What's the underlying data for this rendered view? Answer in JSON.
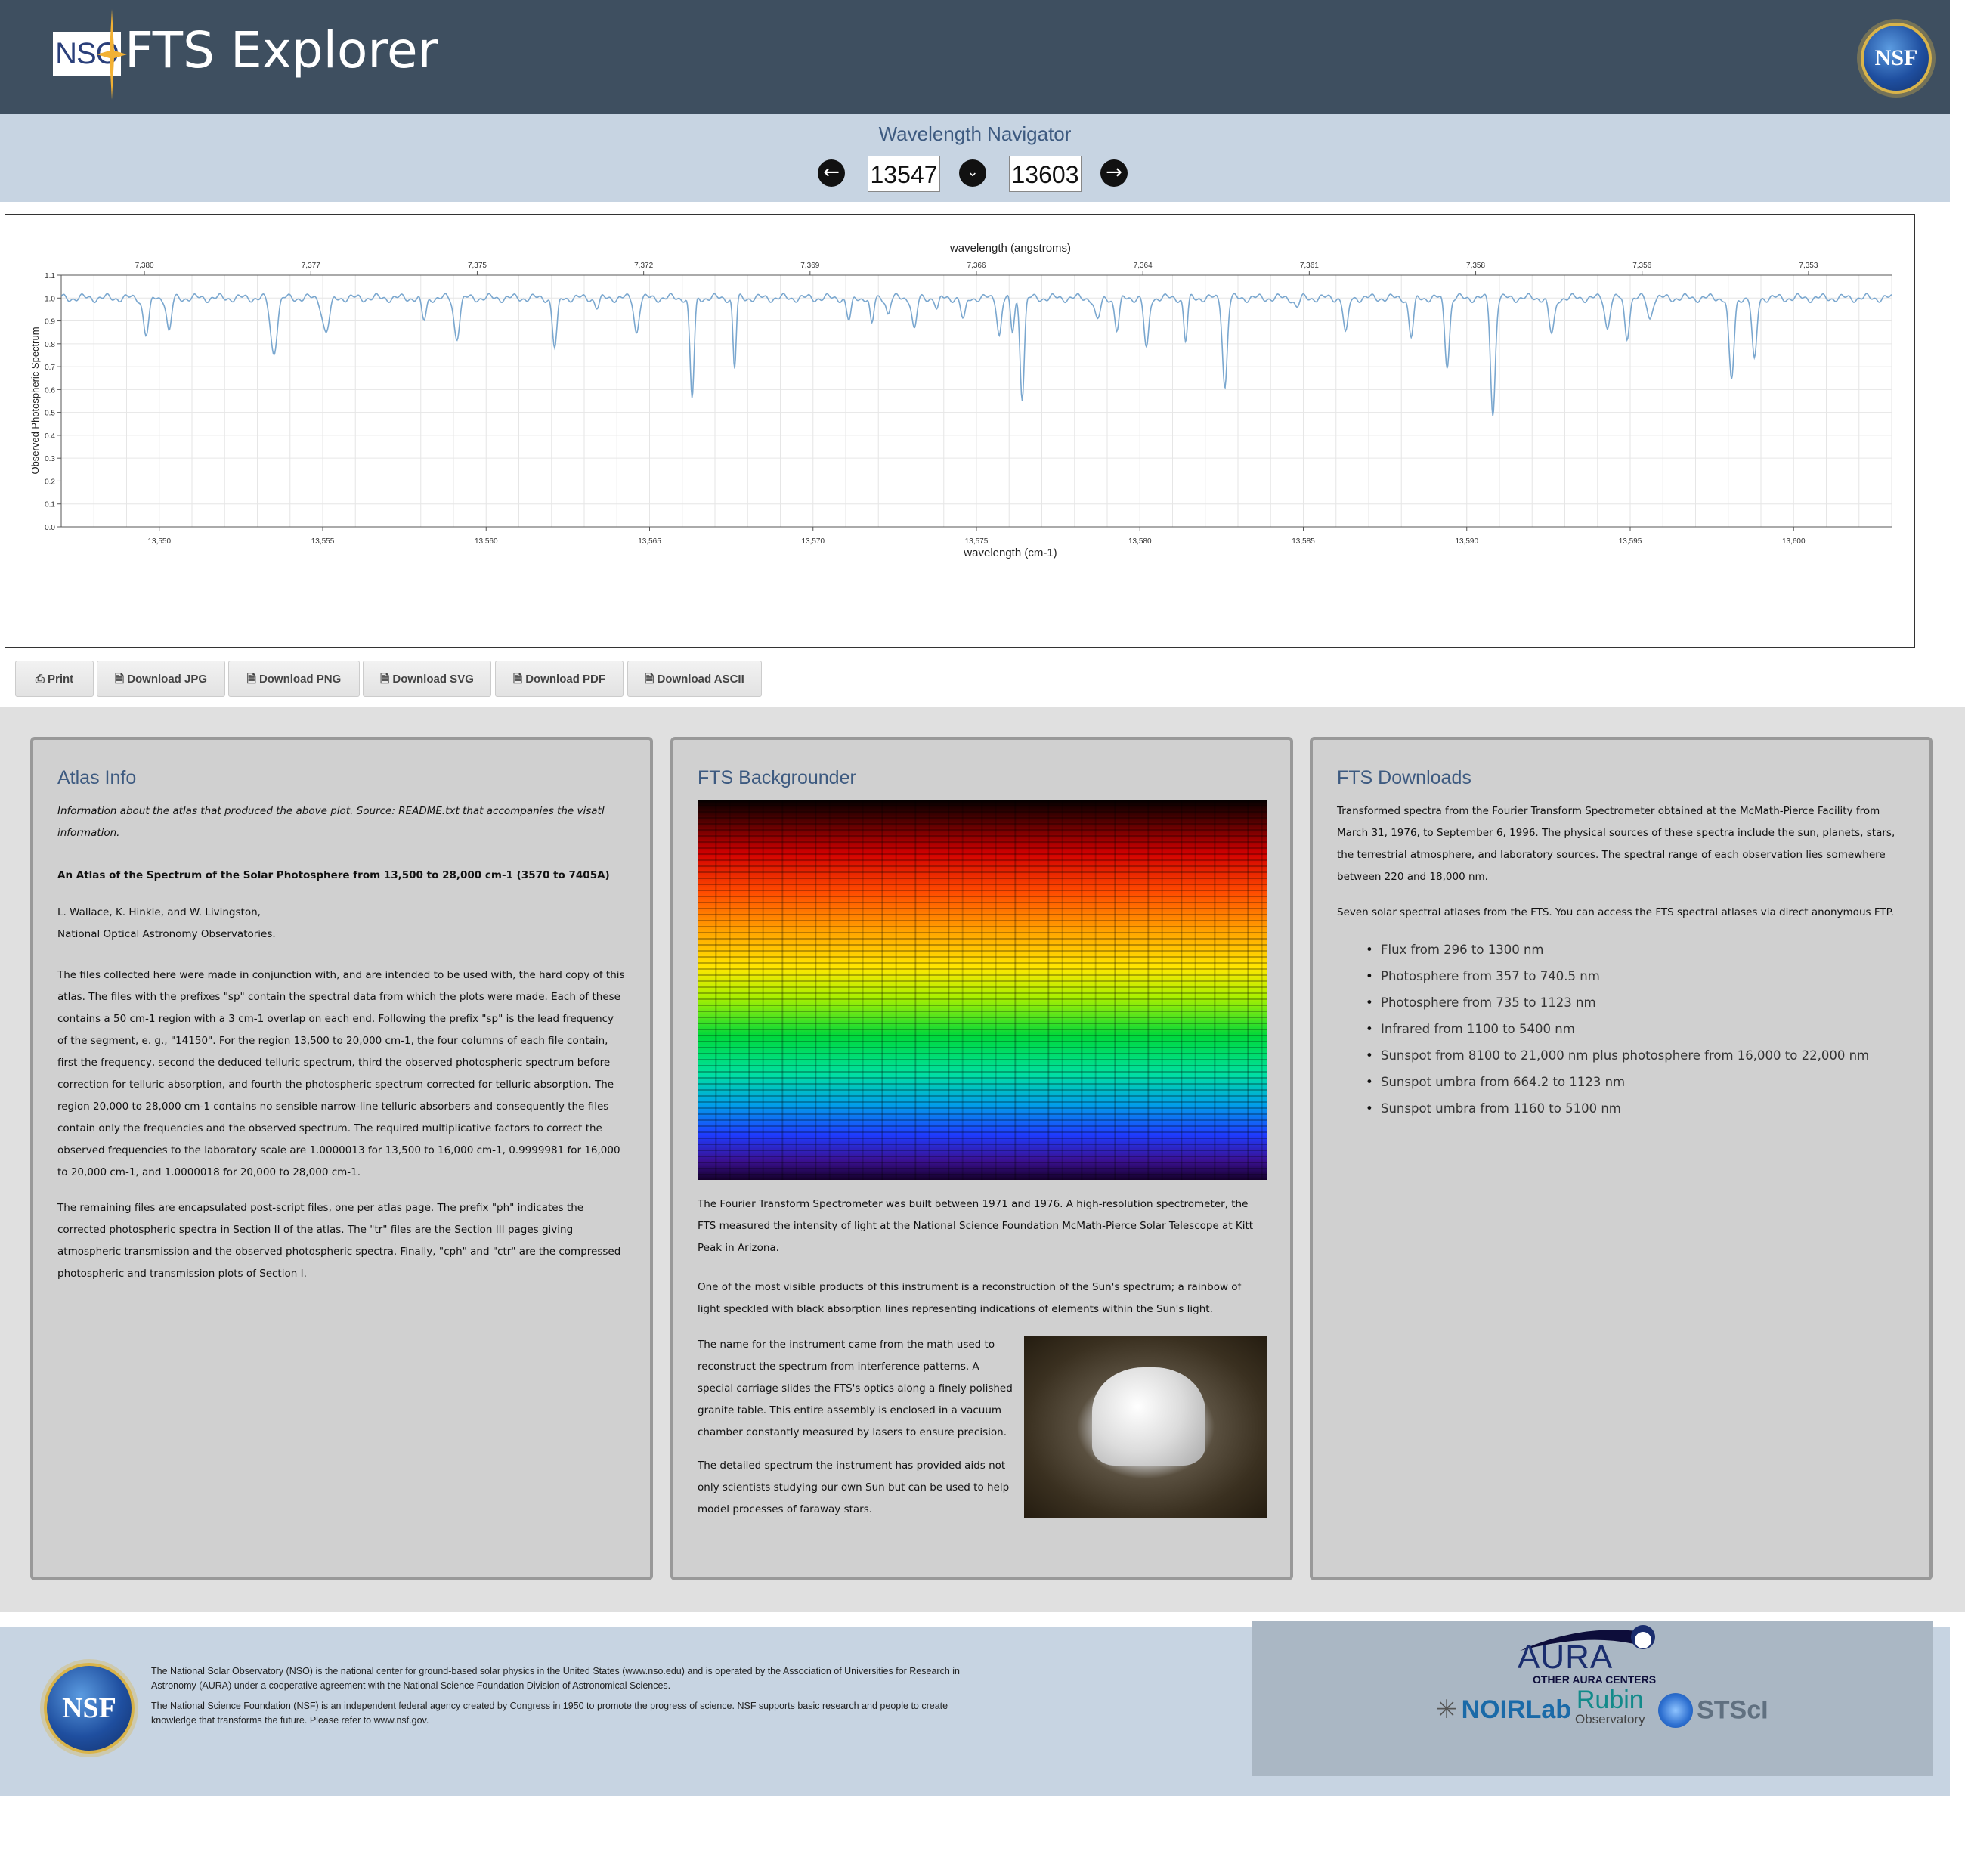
{
  "header": {
    "logo_text": "NSO",
    "title": "FTS Explorer",
    "nsf_logo_text": "NSF"
  },
  "navigator": {
    "title": "Wavelength Navigator",
    "start_value": "13547",
    "end_value": "13603",
    "prev_icon": "arrow-left-icon",
    "range_icon": "chevron-down-icon",
    "next_icon": "arrow-right-icon"
  },
  "chart_data": {
    "type": "line",
    "top_axis_label": "wavelength (angstroms)",
    "top_ticks": [
      "7,380",
      "7,377",
      "7,375",
      "7,372",
      "7,369",
      "7,366",
      "7,364",
      "7,361",
      "7,358",
      "7,356",
      "7,353"
    ],
    "xlabel": "wavelength (cm-1)",
    "ylabel": "Observed Photospheric Spectrum",
    "xlim": [
      13547,
      13603
    ],
    "ylim": [
      0.0,
      1.1
    ],
    "x_ticks": [
      "13,550",
      "13,555",
      "13,560",
      "13,565",
      "13,570",
      "13,575",
      "13,580",
      "13,585",
      "13,590",
      "13,595",
      "13,600"
    ],
    "y_ticks": [
      "0.0",
      "0.1",
      "0.2",
      "0.3",
      "0.4",
      "0.5",
      "0.6",
      "0.7",
      "0.8",
      "0.9",
      "1.0",
      "1.1"
    ],
    "grid": true,
    "color": "#7aa7cf",
    "continuum": 1.0,
    "absorption_lines": [
      {
        "x": 13549.6,
        "depth": 0.16,
        "width": 0.12
      },
      {
        "x": 13550.3,
        "depth": 0.15,
        "width": 0.1
      },
      {
        "x": 13553.5,
        "depth": 0.24,
        "width": 0.14
      },
      {
        "x": 13555.1,
        "depth": 0.15,
        "width": 0.15
      },
      {
        "x": 13558.1,
        "depth": 0.1,
        "width": 0.1
      },
      {
        "x": 13559.1,
        "depth": 0.17,
        "width": 0.12
      },
      {
        "x": 13562.1,
        "depth": 0.22,
        "width": 0.1
      },
      {
        "x": 13563.4,
        "depth": 0.04,
        "width": 0.1
      },
      {
        "x": 13564.6,
        "depth": 0.15,
        "width": 0.1
      },
      {
        "x": 13566.3,
        "depth": 0.44,
        "width": 0.09
      },
      {
        "x": 13567.6,
        "depth": 0.31,
        "width": 0.07
      },
      {
        "x": 13571.1,
        "depth": 0.1,
        "width": 0.1
      },
      {
        "x": 13571.8,
        "depth": 0.12,
        "width": 0.08
      },
      {
        "x": 13572.3,
        "depth": 0.07,
        "width": 0.08
      },
      {
        "x": 13573.1,
        "depth": 0.14,
        "width": 0.1
      },
      {
        "x": 13573.8,
        "depth": 0.05,
        "width": 0.08
      },
      {
        "x": 13574.6,
        "depth": 0.1,
        "width": 0.1
      },
      {
        "x": 13575.7,
        "depth": 0.16,
        "width": 0.09
      },
      {
        "x": 13576.1,
        "depth": 0.15,
        "width": 0.08
      },
      {
        "x": 13576.4,
        "depth": 0.43,
        "width": 0.09
      },
      {
        "x": 13578.7,
        "depth": 0.1,
        "width": 0.12
      },
      {
        "x": 13579.3,
        "depth": 0.14,
        "width": 0.1
      },
      {
        "x": 13580.2,
        "depth": 0.23,
        "width": 0.1
      },
      {
        "x": 13581.4,
        "depth": 0.19,
        "width": 0.08
      },
      {
        "x": 13582.6,
        "depth": 0.39,
        "width": 0.1
      },
      {
        "x": 13584.8,
        "depth": 0.04,
        "width": 0.1
      },
      {
        "x": 13586.3,
        "depth": 0.16,
        "width": 0.1
      },
      {
        "x": 13588.3,
        "depth": 0.17,
        "width": 0.1
      },
      {
        "x": 13589.4,
        "depth": 0.29,
        "width": 0.1
      },
      {
        "x": 13590.8,
        "depth": 0.51,
        "width": 0.1
      },
      {
        "x": 13592.6,
        "depth": 0.16,
        "width": 0.12
      },
      {
        "x": 13594.3,
        "depth": 0.13,
        "width": 0.1
      },
      {
        "x": 13594.9,
        "depth": 0.17,
        "width": 0.1
      },
      {
        "x": 13595.6,
        "depth": 0.09,
        "width": 0.1
      },
      {
        "x": 13598.1,
        "depth": 0.36,
        "width": 0.11
      },
      {
        "x": 13598.8,
        "depth": 0.28,
        "width": 0.1
      }
    ]
  },
  "toolbar": {
    "print": "Print",
    "jpg": "Download JPG",
    "png": "Download PNG",
    "svg": "Download SVG",
    "pdf": "Download PDF",
    "ascii": "Download ASCII"
  },
  "atlas_info": {
    "title": "Atlas Info",
    "intro": "Information about the atlas that produced the above plot. Source: README.txt that accompanies the visatl information.",
    "atlas_title": "An Atlas of the Spectrum of the Solar Photosphere from 13,500 to 28,000 cm-1 (3570 to 7405A)",
    "authors": "L. Wallace, K. Hinkle, and W. Livingston,",
    "institution": "National Optical Astronomy Observatories.",
    "para1": "The files collected here were made in conjunction with, and are intended to be used with, the hard copy of this atlas. The files with the prefixes \"sp\" contain the spectral data from which the plots were made. Each of these contains a 50 cm-1 region with a 3 cm-1 overlap on each end. Following the prefix \"sp\" is the lead frequency of the segment, e. g., \"14150\". For the region 13,500 to 20,000 cm-1, the four columns of each file contain, first the frequency, second the deduced telluric spectrum, third the observed photospheric spectrum before correction for telluric absorption, and fourth the photospheric spectrum corrected for telluric absorption. The region 20,000 to 28,000 cm-1 contains no sensible narrow-line telluric absorbers and consequently the files contain only the frequencies and the observed spectrum. The required multiplicative factors to correct the observed frequencies to the laboratory scale are 1.0000013 for 13,500 to 16,000 cm-1, 0.9999981 for 16,000 to 20,000 cm-1, and 1.0000018 for 20,000 to 28,000 cm-1.",
    "para2": "The remaining files are encapsulated post-script files, one per atlas page. The prefix \"ph\" indicates the corrected photospheric spectra in Section II of the atlas. The \"tr\" files are the Section III pages giving atmospheric transmission and the observed photospheric spectra. Finally, \"cph\" and \"ctr\" are the compressed photospheric and transmission plots of Section I."
  },
  "backgrounder": {
    "title": "FTS Backgrounder",
    "para1": "The Fourier Transform Spectrometer was built between 1971 and 1976. A high-resolution spectrometer, the FTS measured the intensity of light at the National Science Foundation McMath-Pierce Solar Telescope at Kitt Peak in Arizona.",
    "para2": "One of the most visible products of this instrument is a reconstruction of the Sun's spectrum; a rainbow of light speckled with black absorption lines representing indications of elements within the Sun's light.",
    "para3": "The name for the instrument came from the math used to reconstruct the spectrum from interference patterns. A special carriage slides the FTS's optics along a finely polished granite table. This entire assembly is enclosed in a vacuum chamber constantly measured by lasers to ensure precision.",
    "para4": "The detailed spectrum the instrument has provided aids not only scientists studying our own Sun but can be used to help model processes of faraway stars."
  },
  "downloads": {
    "title": "FTS Downloads",
    "para1": "Transformed spectra from the Fourier Transform Spectrometer obtained at the McMath-Pierce Facility from March 31, 1976, to September 6, 1996. The physical sources of these spectra include the sun, planets, stars, the terrestrial atmosphere, and laboratory sources. The spectral range of each observation lies somewhere between 220 and 18,000 nm.",
    "para2": "Seven solar spectral atlases from the FTS. You can access the FTS spectral atlases via direct anonymous FTP.",
    "items": [
      "Flux from 296 to 1300 nm",
      "Photosphere from 357 to 740.5 nm",
      "Photosphere from 735 to 1123 nm",
      "Infrared from 1100 to 5400 nm",
      "Sunspot from 8100 to 21,000 nm plus photosphere from 16,000 to 22,000 nm",
      "Sunspot umbra from 664.2 to 1123 nm",
      "Sunspot umbra from 1160 to 5100 nm"
    ]
  },
  "footer": {
    "nso_text": "The National Solar Observatory (NSO) is the national center for ground-based solar physics in the United States (www.nso.edu) and is operated by the Association of Universities for Research in Astronomy (AURA) under a cooperative agreement with the National Science Foundation Division of Astronomical Sciences.",
    "nsf_text": "The National Science Foundation (NSF) is an independent federal agency created by Congress in 1950 to promote the progress of science. NSF supports basic research and people to create knowledge that transforms the future. Please refer to www.nsf.gov.",
    "aura_logo_text": "AURA",
    "other_centers": "OTHER AURA CENTERS",
    "noirlab": "NOIRLab",
    "rubin": "Rubin",
    "rubin_sub": "Observatory",
    "stsci": "STScI"
  },
  "colors": {
    "header_bg": "#3e4f60",
    "nav_bg": "#c7d4e2",
    "panel_bg": "#d0d0d0",
    "heading_blue": "#3d5a80",
    "line": "#7aa7cf"
  }
}
